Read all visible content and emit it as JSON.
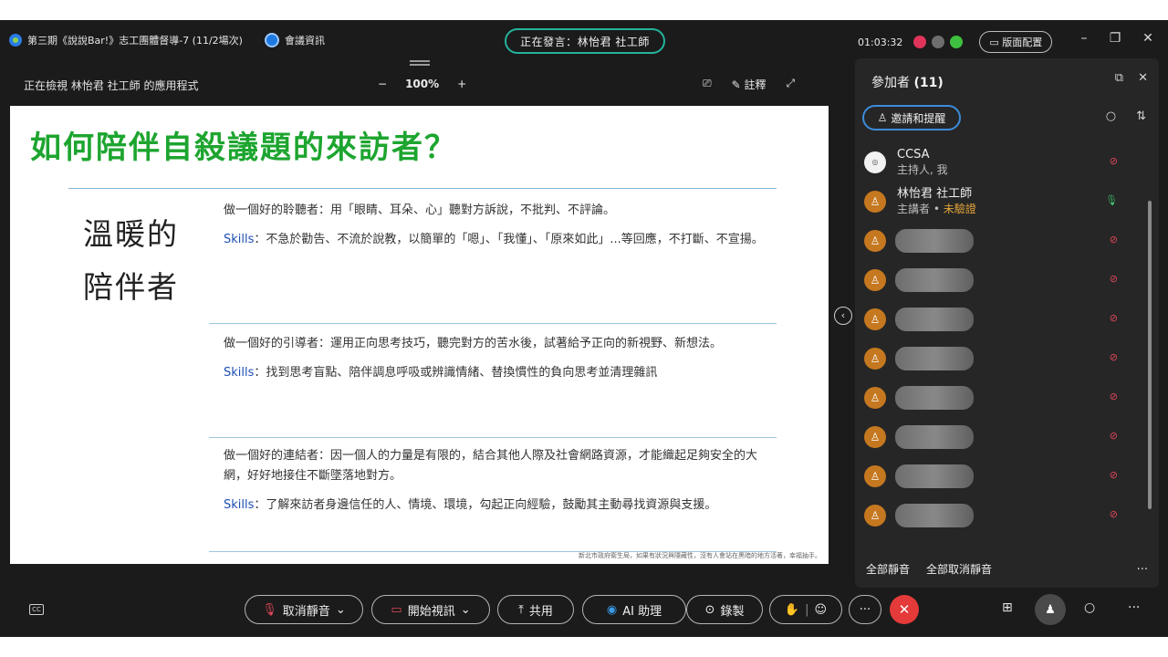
{
  "titlebar": {
    "meeting_title": "第三期《說說Bar!》志工團體督導-7 (11/2場次)",
    "meeting_info_label": "會議資訊",
    "speaking_label": "正在發言：林怡君 社工師",
    "timer": "01:03:32",
    "layout_label": "版面配置",
    "status_colors": [
      "#e0345a",
      "#6e6e6e",
      "#3fbf3f"
    ]
  },
  "subbar": {
    "viewing_label": "正在檢視 林怡君 社工師 的應用程式",
    "zoom_out": "−",
    "zoom_level": "100%",
    "zoom_in": "+",
    "annotate_label": "註釋"
  },
  "slide": {
    "title": "如何陪伴自殺議題的來訪者？",
    "left_label_line1": "溫暖的",
    "left_label_line2": "陪伴者",
    "sections": [
      {
        "text": "做一個好的聆聽者：用「眼睛、耳朵、心」聽對方訴說，不批判、不評論。",
        "skills_label": "Skills",
        "skills_text": "：不急於勸告、不流於說教，以簡單的「嗯」、「我懂」、「原來如此」...等回應，不打斷、不宣揚。"
      },
      {
        "text": "做一個好的引導者：運用正向思考技巧，聽完對方的苦水後，試著給予正向的新視野、新想法。",
        "skills_label": "Skills",
        "skills_text": "：找到思考盲點、陪伴調息呼吸或辨識情緒、替換慣性的負向思考並清理雜訊"
      },
      {
        "text": "做一個好的連結者：因一個人的力量是有限的，結合其他人際及社會網路資源，才能織起足夠安全的大網，好好地接住不斷墜落地對方。",
        "skills_label": "Skills",
        "skills_text": "：了解來訪者身邊信任的人、情境、環境，勾起正向經驗，鼓勵其主動尋找資源與支援。"
      }
    ],
    "footnote": "新北市政府衛生局，如果有狀況與隱藏性，沒有人會站在黑暗的地方活著，幸福抽手。"
  },
  "panel": {
    "title": "參加者",
    "count": "(11)",
    "invite_label": "邀請和提醒",
    "participants": [
      {
        "name": "CCSA",
        "sub": "主持人, 我",
        "warn": "",
        "mic": "muted",
        "blurred": false
      },
      {
        "name": "林怡君 社工師",
        "sub": "主講者 • ",
        "warn": "未驗證",
        "mic": "on",
        "blurred": false
      },
      {
        "name": "",
        "sub": "",
        "warn": "",
        "mic": "muted",
        "blurred": true
      },
      {
        "name": "",
        "sub": "",
        "warn": "",
        "mic": "muted",
        "blurred": true
      },
      {
        "name": "",
        "sub": "",
        "warn": "",
        "mic": "muted",
        "blurred": true
      },
      {
        "name": "",
        "sub": "",
        "warn": "",
        "mic": "muted",
        "blurred": true
      },
      {
        "name": "",
        "sub": "",
        "warn": "",
        "mic": "muted",
        "blurred": true
      },
      {
        "name": "",
        "sub": "",
        "warn": "",
        "mic": "muted",
        "blurred": true
      },
      {
        "name": "",
        "sub": "",
        "warn": "",
        "mic": "muted",
        "blurred": true
      },
      {
        "name": "",
        "sub": "",
        "warn": "",
        "mic": "muted",
        "blurred": true
      }
    ],
    "mute_all": "全部靜音",
    "unmute_all": "全部取消靜音"
  },
  "controls": {
    "unmute_label": "取消靜音",
    "video_label": "開始視訊",
    "share_label": "共用",
    "ai_label": "AI 助理",
    "record_label": "錄製",
    "more_label": "···",
    "end_label": "✕"
  }
}
